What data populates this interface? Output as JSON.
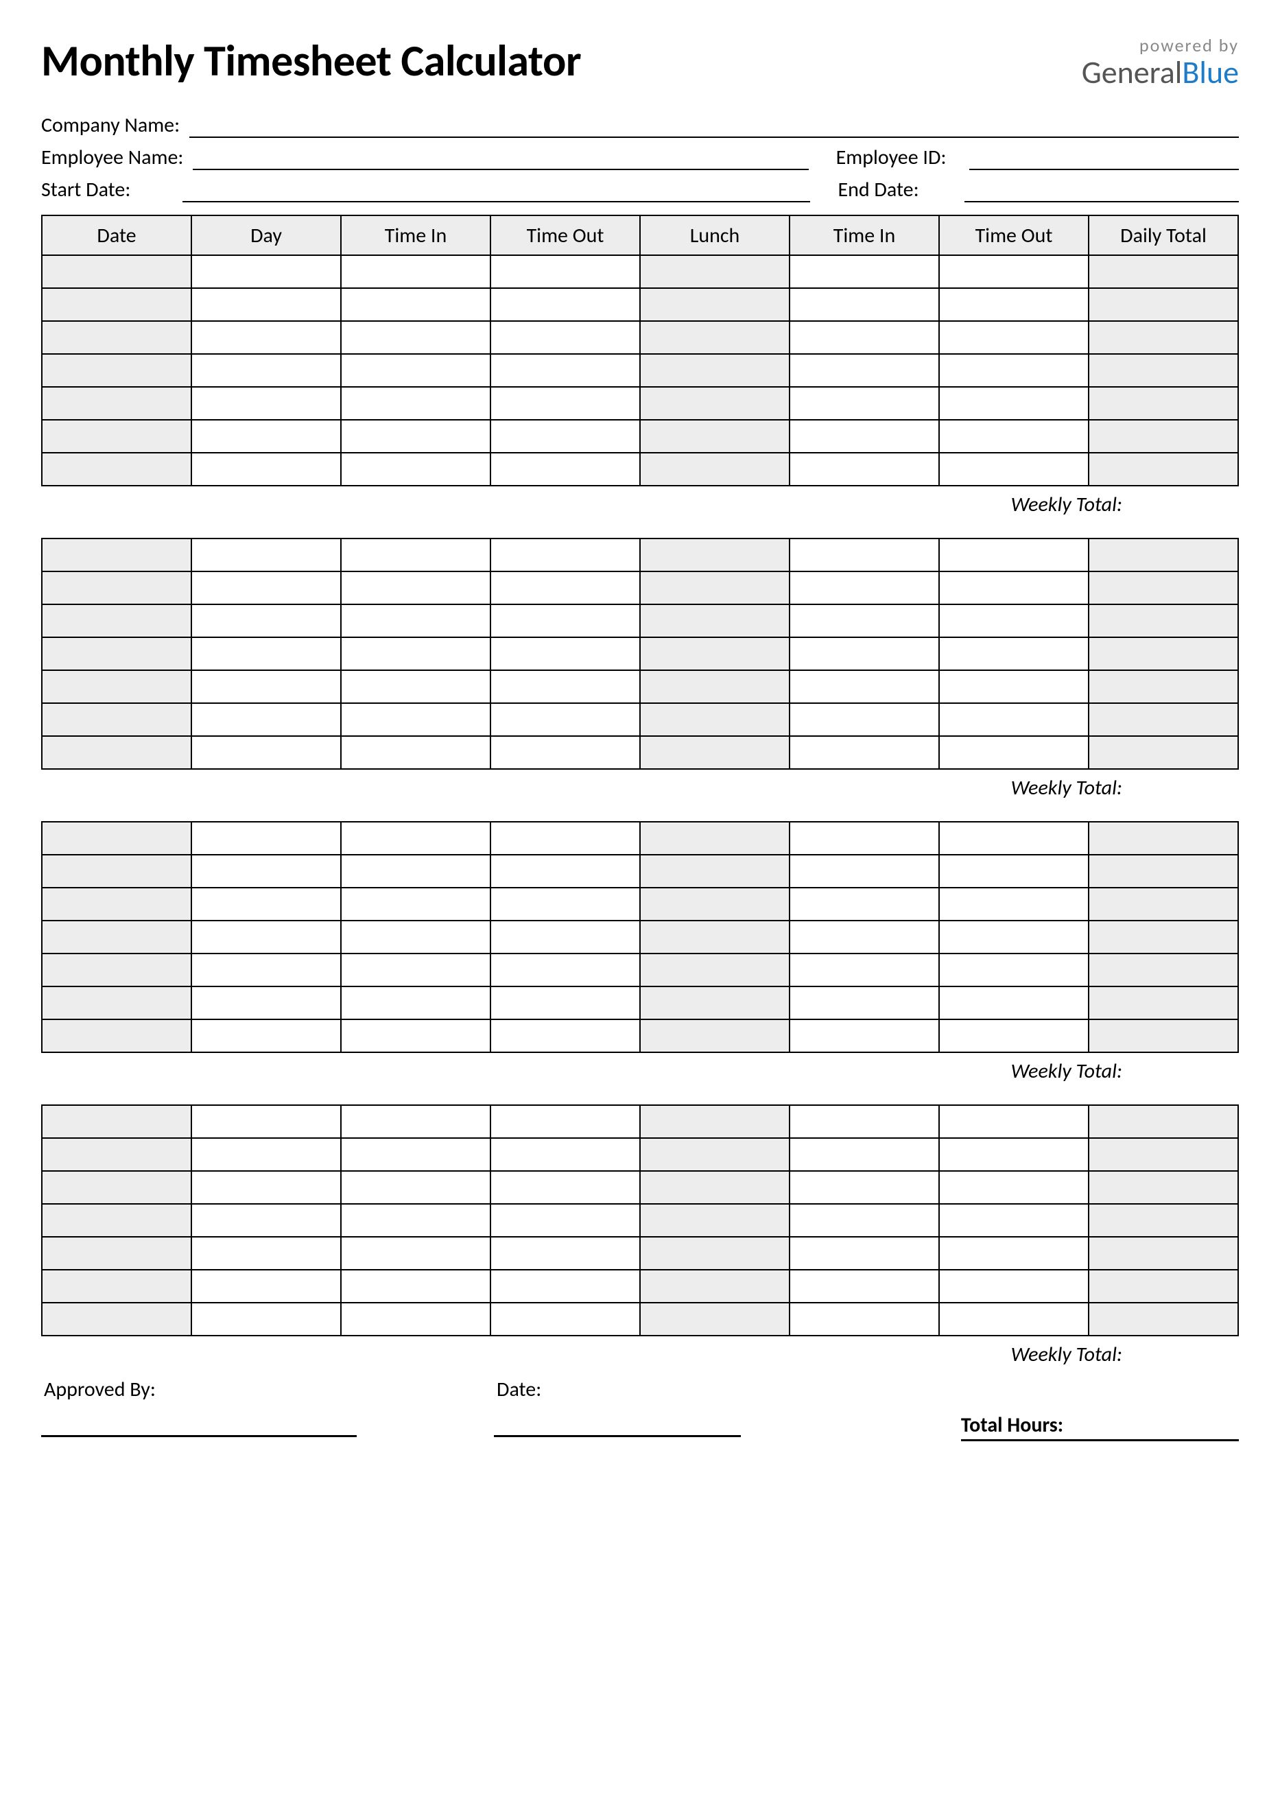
{
  "title": "Monthly Timesheet Calculator",
  "brand": {
    "powered": "powered by",
    "name1": "General",
    "name2": "Blue"
  },
  "info": {
    "company_label": "Company Name:",
    "employee_label": "Employee Name:",
    "employee_id_label": "Employee ID:",
    "start_date_label": "Start Date:",
    "end_date_label": "End Date:"
  },
  "columns": [
    "Date",
    "Day",
    "Time In",
    "Time Out",
    "Lunch",
    "Time In",
    "Time Out",
    "Daily Total"
  ],
  "weekly_total_label": "Weekly Total:",
  "blocks": [
    {
      "rows": 7
    },
    {
      "rows": 7
    },
    {
      "rows": 7
    },
    {
      "rows": 7
    }
  ],
  "footer": {
    "approved_label": "Approved By:",
    "date_label": "Date:",
    "total_hours_label": "Total Hours:"
  }
}
